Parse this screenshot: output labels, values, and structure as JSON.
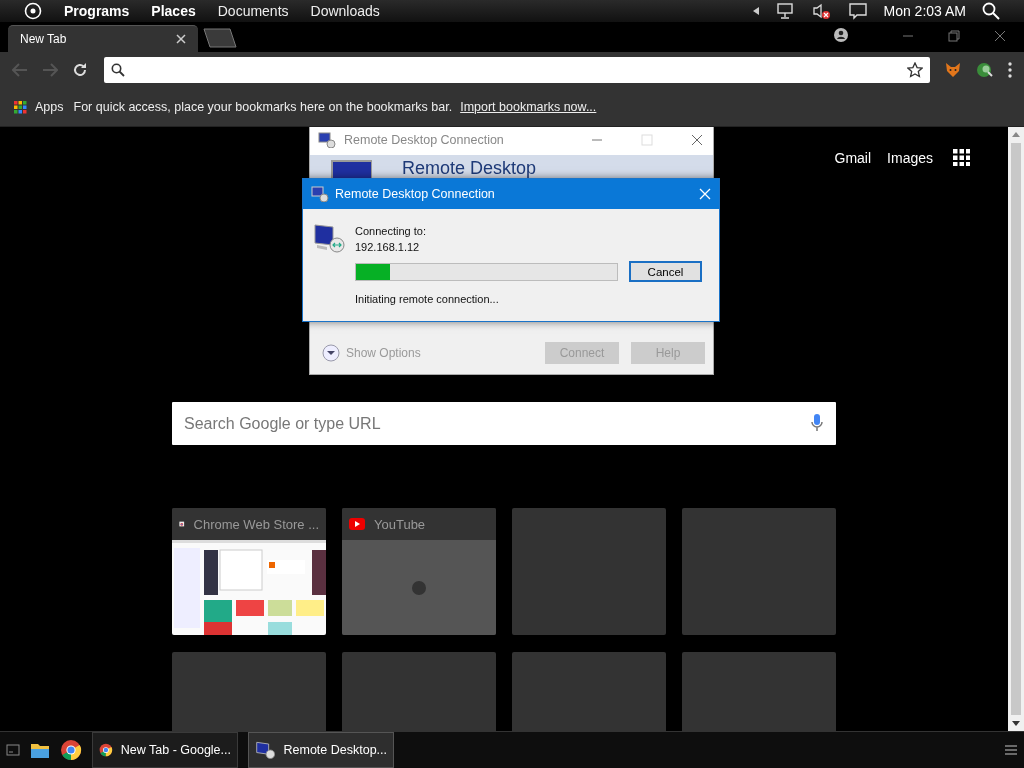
{
  "top_bar": {
    "menus": [
      {
        "label": "Programs",
        "emphasized": true
      },
      {
        "label": "Places",
        "emphasized": true
      },
      {
        "label": "Documents",
        "emphasized": false
      },
      {
        "label": "Downloads",
        "emphasized": false
      }
    ],
    "clock": "Mon 2:03 AM"
  },
  "tabs": [
    {
      "label": "New Tab",
      "selected": true
    }
  ],
  "bookmarks_bar": {
    "apps": "Apps",
    "hint": "For quick access, place your bookmarks here on the bookmarks bar.",
    "import_link": "Import bookmarks now..."
  },
  "new_tab_page": {
    "links": [
      "Gmail",
      "Images"
    ],
    "search": {
      "placeholder": "Search Google or type URL"
    },
    "tiles": [
      {
        "title": "Chrome Web Store ...",
        "kind": "store"
      },
      {
        "title": "YouTube",
        "kind": "video"
      },
      {
        "kind": "empty"
      },
      {
        "kind": "empty"
      },
      {
        "kind": "empty"
      },
      {
        "kind": "empty"
      },
      {
        "kind": "empty"
      },
      {
        "kind": "empty"
      }
    ]
  },
  "back_dialog": {
    "title": "Remote Desktop Connection",
    "heading": "Remote Desktop",
    "show_options": "Show Options",
    "buttons": [
      {
        "label": "Connect",
        "disabled": true
      },
      {
        "label": "Help",
        "disabled": true
      }
    ]
  },
  "front_dialog": {
    "title": "Remote Desktop Connection",
    "connecting_label": "Connecting to:",
    "address": "192.168.1.12",
    "progress": {
      "level": 0.13
    },
    "cancel": "Cancel",
    "status": "Initiating remote connection..."
  },
  "taskbar": {
    "windows": [
      {
        "label": "New Tab - Google...",
        "kind": "browser",
        "selected": false
      },
      {
        "label": "Remote Desktop...",
        "kind": "remote",
        "selected": true
      }
    ]
  }
}
